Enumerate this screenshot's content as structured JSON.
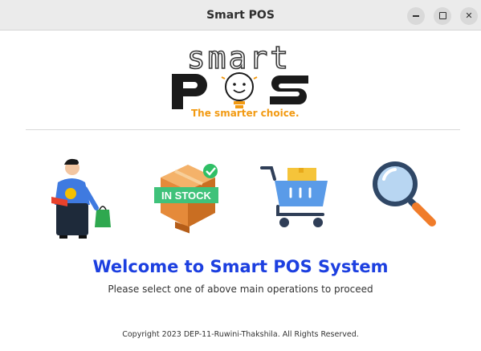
{
  "window": {
    "title": "Smart POS"
  },
  "logo": {
    "word_top": "smart",
    "word_bottom": "pos",
    "tagline": "The smarter choice."
  },
  "tiles": [
    {
      "name": "customer",
      "icon": "shopper-person-icon"
    },
    {
      "name": "inventory",
      "icon": "in-stock-box-icon",
      "badge": "IN STOCK"
    },
    {
      "name": "sales",
      "icon": "shopping-cart-icon"
    },
    {
      "name": "search",
      "icon": "magnifying-glass-icon"
    }
  ],
  "main": {
    "welcome": "Welcome to Smart POS System",
    "instruction": "Please select one of above main operations to proceed"
  },
  "footer": {
    "copyright": "Copyright 2023 DEP-11-Ruwini-Thakshila. All Rights Reserved."
  },
  "colors": {
    "accent": "#1c3fe0",
    "tagline": "#f29a12"
  }
}
